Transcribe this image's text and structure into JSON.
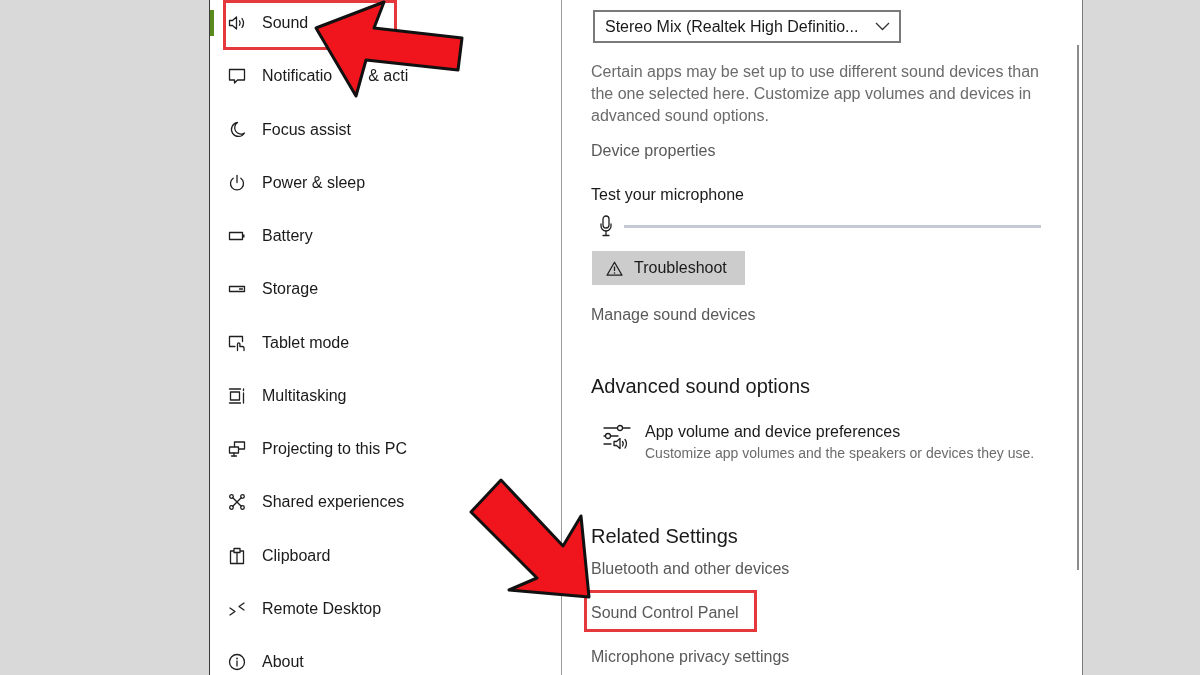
{
  "sidebar": {
    "items": [
      {
        "label": "Sound",
        "selected": true,
        "highlighted": true
      },
      {
        "label": "Notificatio",
        "label_tail": "& acti",
        "selected": false,
        "highlighted": false
      },
      {
        "label": "Focus assist",
        "selected": false,
        "highlighted": false
      },
      {
        "label": "Power & sleep",
        "selected": false,
        "highlighted": false
      },
      {
        "label": "Battery",
        "selected": false,
        "highlighted": false
      },
      {
        "label": "Storage",
        "selected": false,
        "highlighted": false
      },
      {
        "label": "Tablet mode",
        "selected": false,
        "highlighted": false
      },
      {
        "label": "Multitasking",
        "selected": false,
        "highlighted": false
      },
      {
        "label": "Projecting to this PC",
        "selected": false,
        "highlighted": false
      },
      {
        "label": "Shared experiences",
        "selected": false,
        "highlighted": false
      },
      {
        "label": "Clipboard",
        "selected": false,
        "highlighted": false
      },
      {
        "label": "Remote Desktop",
        "selected": false,
        "highlighted": false
      },
      {
        "label": "About",
        "selected": false,
        "highlighted": false
      }
    ]
  },
  "content": {
    "device_dropdown": {
      "value": "Stereo Mix (Realtek High Definitio..."
    },
    "device_note": "Certain apps may be set up to use different sound devices than the one selected here. Customize app volumes and devices in advanced sound options.",
    "device_properties_link": "Device properties",
    "microphone_test": {
      "label": "Test your microphone",
      "level": 0
    },
    "troubleshoot_button": "Troubleshoot",
    "manage_devices_link": "Manage sound devices",
    "advanced": {
      "heading": "Advanced sound options",
      "options": [
        {
          "title": "App volume and device preferences",
          "description": "Customize app volumes and the speakers or devices they use."
        }
      ]
    },
    "related": {
      "heading": "Related Settings",
      "links": [
        {
          "label": "Bluetooth and other devices",
          "highlighted": false
        },
        {
          "label": "Sound Control Panel",
          "highlighted": true
        },
        {
          "label": "Microphone privacy settings",
          "highlighted": false
        }
      ]
    }
  }
}
